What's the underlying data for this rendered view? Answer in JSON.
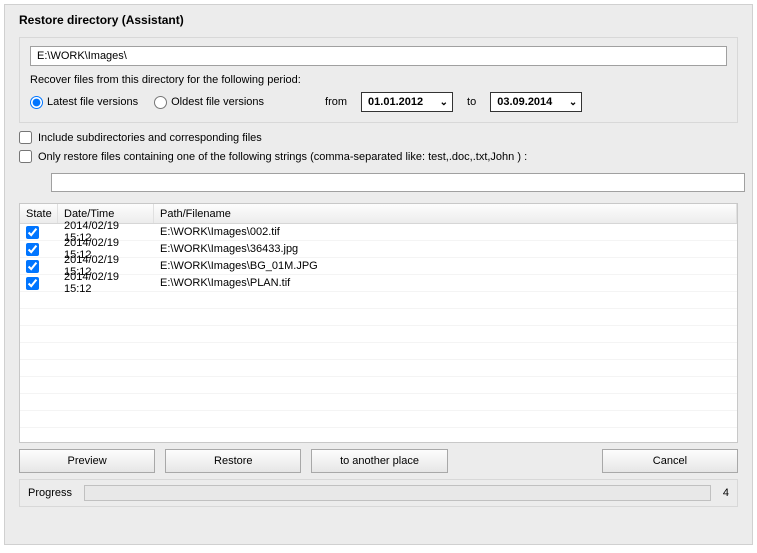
{
  "title": "Restore directory (Assistant)",
  "path_value": "E:\\WORK\\Images\\",
  "recover_label": "Recover files from this directory for the following period:",
  "radio": {
    "latest": "Latest file versions",
    "oldest": "Oldest file versions"
  },
  "from_label": "from",
  "to_label": "to",
  "date_from": "01.01.2012",
  "date_to": "03.09.2014",
  "include_sub": "Include subdirectories and corresponding files",
  "only_restore": "Only restore files containing one of the following strings (comma-separated like: test,.doc,.txt,John ) :",
  "filter_value": "",
  "columns": {
    "state": "State",
    "datetime": "Date/Time",
    "path": "Path/Filename"
  },
  "rows": [
    {
      "checked": true,
      "dt": "2014/02/19 15:12",
      "path": "E:\\WORK\\Images\\002.tif"
    },
    {
      "checked": true,
      "dt": "2014/02/19 15:12",
      "path": "E:\\WORK\\Images\\36433.jpg"
    },
    {
      "checked": true,
      "dt": "2014/02/19 15:12",
      "path": "E:\\WORK\\Images\\BG_01M.JPG"
    },
    {
      "checked": true,
      "dt": "2014/02/19 15:12",
      "path": "E:\\WORK\\Images\\PLAN.tif"
    }
  ],
  "buttons": {
    "preview": "Preview",
    "restore": "Restore",
    "another": "to another place",
    "cancel": "Cancel"
  },
  "progress_label": "Progress",
  "progress_count": "4"
}
